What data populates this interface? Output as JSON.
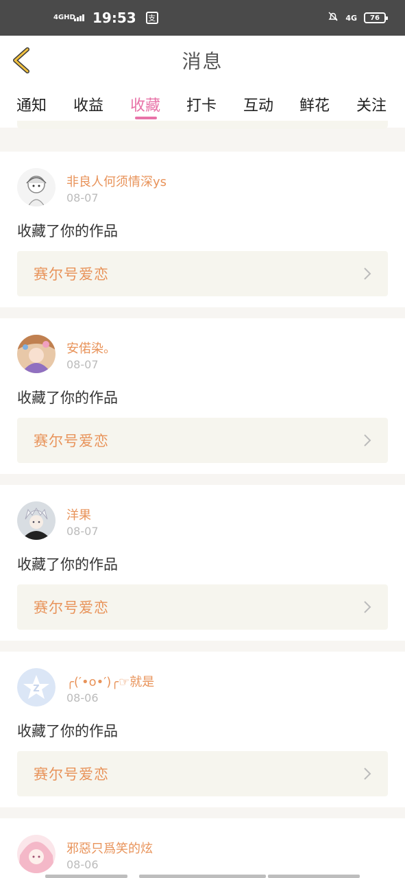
{
  "status_bar": {
    "network_left": "4GHD",
    "time": "19:53",
    "app_badge": "支",
    "network_right": "4G",
    "battery": "76"
  },
  "header": {
    "title": "消息",
    "back_icon": "chevron-left-icon"
  },
  "tabs": [
    {
      "label": "通知",
      "active": false
    },
    {
      "label": "收益",
      "active": false
    },
    {
      "label": "收藏",
      "active": true
    },
    {
      "label": "打卡",
      "active": false
    },
    {
      "label": "互动",
      "active": false
    },
    {
      "label": "鲜花",
      "active": false
    },
    {
      "label": "关注",
      "active": false
    }
  ],
  "colors": {
    "accent": "#e873a8",
    "name": "#e8935a",
    "card_bg": "#f6f5ee"
  },
  "notifications": [
    {
      "username": "非良人何须情深ys",
      "date": "08-07",
      "action": "收藏了你的作品",
      "work": "赛尔号爱恋"
    },
    {
      "username": "安偌染。",
      "date": "08-07",
      "action": "收藏了你的作品",
      "work": "赛尔号爱恋"
    },
    {
      "username": "洋果",
      "date": "08-07",
      "action": "收藏了你的作品",
      "work": "赛尔号爱恋"
    },
    {
      "username": "╭(′•ο•′)╭☞就是",
      "date": "08-06",
      "action": "收藏了你的作品",
      "work": "赛尔号爱恋"
    },
    {
      "username": "邪惡只爲笑的炫",
      "date": "08-06",
      "action": "",
      "work": ""
    }
  ]
}
